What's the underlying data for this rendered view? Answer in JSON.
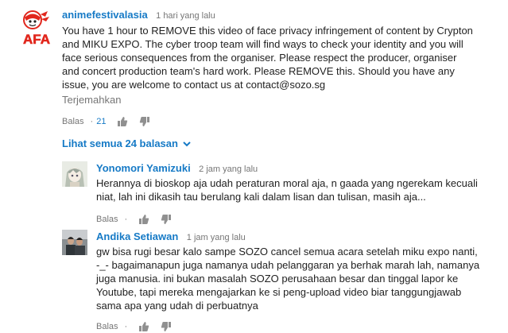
{
  "main_comment": {
    "author": "animefestivalasia",
    "time": "1 hari yang lalu",
    "lines": [
      "You have 1 hour to REMOVE this video of face privacy infringement of content by Crypton",
      "and MIKU EXPO. The cyber troop team will find ways to check your identity and you will",
      "face serious consequences from the organiser. Please respect the producer, organiser",
      "and concert production team's hard work. Please REMOVE this. Should you have any",
      "issue, you are welcome to contact us at contact@sozo.sg"
    ],
    "translate_label": "Terjemahkan",
    "reply_label": "Balas",
    "like_count": "21",
    "avatar_text": "AFA"
  },
  "view_replies_label": "Lihat semua 24 balasan",
  "replies": [
    {
      "author": "Yonomori Yamizuki",
      "time": "2 jam yang lalu",
      "lines": [
        "Herannya di bioskop aja udah peraturan moral aja, n gaada yang ngerekam kecuali",
        "niat, lah ini dikasih tau berulang kali dalam lisan dan tulisan, masih aja..."
      ],
      "reply_label": "Balas"
    },
    {
      "author": "Andika Setiawan",
      "time": "1 jam yang lalu",
      "lines": [
        "gw bisa rugi besar kalo sampe SOZO cancel semua acara setelah miku expo nanti,",
        "-_- bagaimanapun juga namanya udah pelanggaran ya berhak marah lah, namanya",
        "juga manusia. ini bukan masalah SOZO perusahaan besar dan tinggal lapor ke",
        "Youtube, tapi mereka mengajarkan ke si peng-upload video biar tanggungjawab",
        "sama apa yang udah di perbuatnya"
      ],
      "reply_label": "Balas"
    }
  ],
  "colors": {
    "link": "#167ac6",
    "meta": "#767676",
    "text": "#222222",
    "afa_red": "#e1271d"
  },
  "icons": [
    "thumbs-up-icon",
    "thumbs-down-icon",
    "chevron-down-icon"
  ]
}
